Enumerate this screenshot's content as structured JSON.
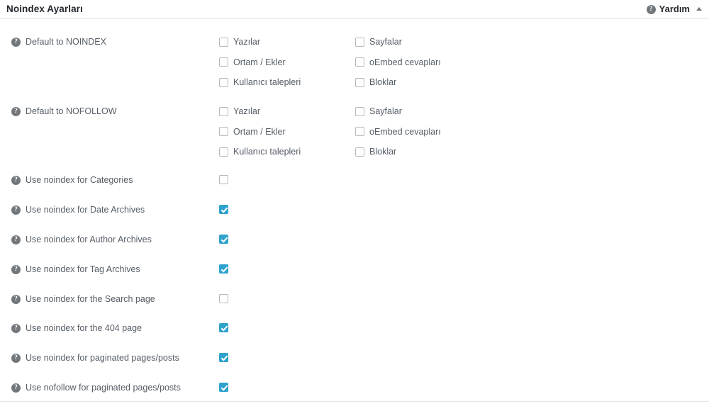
{
  "header": {
    "title": "Noindex Ayarları",
    "help_label": "Yardım",
    "help_icon": "question-mark-circle-icon",
    "collapse_icon": "caret-up-icon"
  },
  "colors": {
    "checkbox_checked": "#2ea2cc",
    "checkbox_border": "#b4b9be",
    "label_text": "#555d66",
    "title_text": "#23282d",
    "panel_background": "#ffffff",
    "rule": "#e5e5e5",
    "help_icon_background": "#72777c"
  },
  "groups": [
    {
      "label": "Default to NOINDEX",
      "help_icon": "question-mark-circle-icon",
      "options": [
        {
          "label": "Yazılar",
          "checked": false,
          "column": 0,
          "line": 0
        },
        {
          "label": "Sayfalar",
          "checked": false,
          "column": 1,
          "line": 0
        },
        {
          "label": "Ortam / Ekler",
          "checked": false,
          "column": 0,
          "line": 1
        },
        {
          "label": "oEmbed cevapları",
          "checked": false,
          "column": 1,
          "line": 1
        },
        {
          "label": "Kullanıcı talepleri",
          "checked": false,
          "column": 0,
          "line": 2
        },
        {
          "label": "Bloklar",
          "checked": false,
          "column": 1,
          "line": 2
        }
      ]
    },
    {
      "label": "Default to NOFOLLOW",
      "help_icon": "question-mark-circle-icon",
      "options": [
        {
          "label": "Yazılar",
          "checked": false,
          "column": 0,
          "line": 0
        },
        {
          "label": "Sayfalar",
          "checked": false,
          "column": 1,
          "line": 0
        },
        {
          "label": "Ortam / Ekler",
          "checked": false,
          "column": 0,
          "line": 1
        },
        {
          "label": "oEmbed cevapları",
          "checked": false,
          "column": 1,
          "line": 1
        },
        {
          "label": "Kullanıcı talepleri",
          "checked": false,
          "column": 0,
          "line": 2
        },
        {
          "label": "Bloklar",
          "checked": false,
          "column": 1,
          "line": 2
        }
      ]
    }
  ],
  "toggles": [
    {
      "label": "Use noindex for Categories",
      "checked": false,
      "help_icon": "question-mark-circle-icon"
    },
    {
      "label": "Use noindex for Date Archives",
      "checked": true,
      "help_icon": "question-mark-circle-icon"
    },
    {
      "label": "Use noindex for Author Archives",
      "checked": true,
      "help_icon": "question-mark-circle-icon"
    },
    {
      "label": "Use noindex for Tag Archives",
      "checked": true,
      "help_icon": "question-mark-circle-icon"
    },
    {
      "label": "Use noindex for the Search page",
      "checked": false,
      "help_icon": "question-mark-circle-icon"
    },
    {
      "label": "Use noindex for the 404 page",
      "checked": true,
      "help_icon": "question-mark-circle-icon"
    },
    {
      "label": "Use noindex for paginated pages/posts",
      "checked": true,
      "help_icon": "question-mark-circle-icon"
    },
    {
      "label": "Use nofollow for paginated pages/posts",
      "checked": true,
      "help_icon": "question-mark-circle-icon"
    }
  ],
  "layout": {
    "group_tops": [
      24,
      122
    ],
    "toggle_tops": [
      219,
      261,
      303,
      345,
      387,
      428,
      470,
      512
    ],
    "sub_line_offsets": [
      0,
      28.5,
      57
    ],
    "column_lefts": [
      309,
      501
    ]
  }
}
